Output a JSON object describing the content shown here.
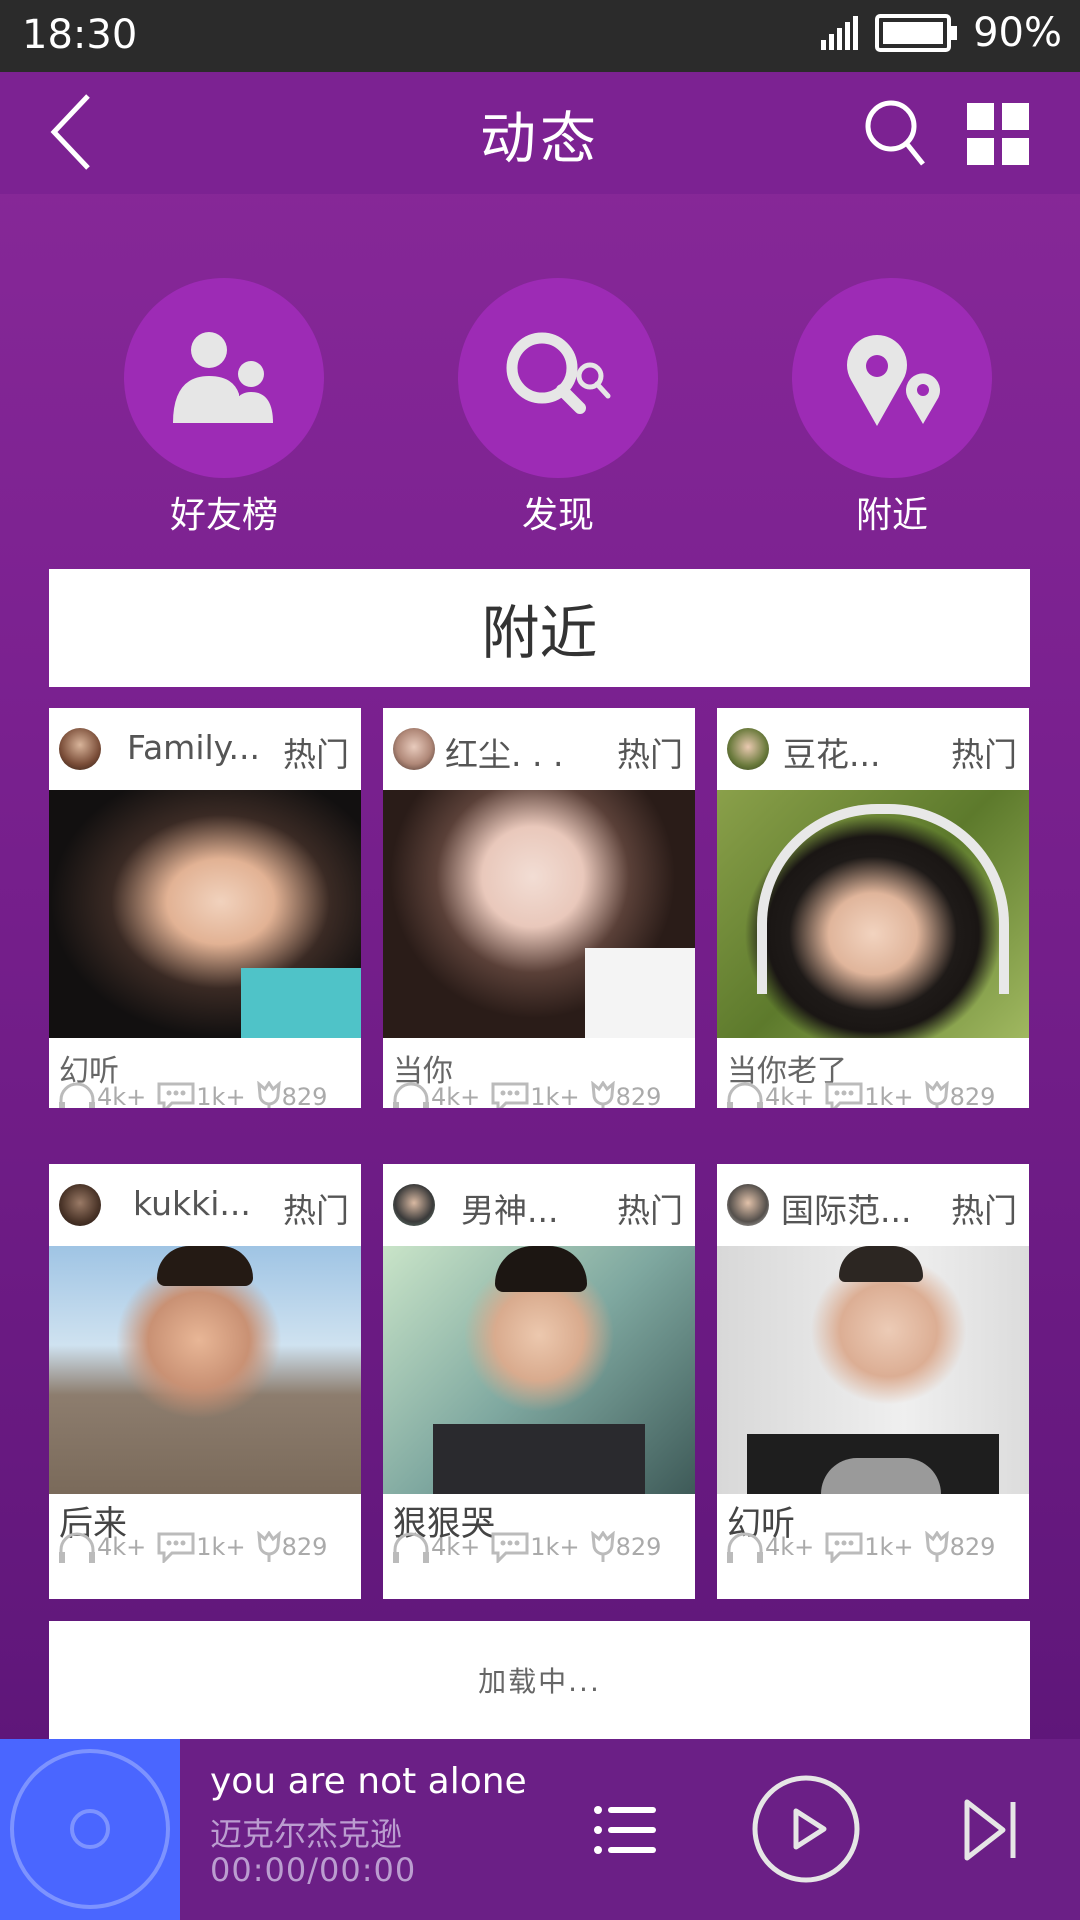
{
  "status": {
    "time": "18:30",
    "battery": "90%"
  },
  "appbar": {
    "title": "动态"
  },
  "shortcuts": [
    {
      "label": "好友榜",
      "icon": "friends-icon"
    },
    {
      "label": "发现",
      "icon": "discover-search-icon"
    },
    {
      "label": "附近",
      "icon": "nearby-location-icon"
    }
  ],
  "section": {
    "title": "附近"
  },
  "cards": [
    {
      "user": "Family...",
      "hot": "热门",
      "song": "幻听",
      "listens": "4k+",
      "comments": "1k+",
      "likes": "829"
    },
    {
      "user": "红尘. . .",
      "hot": "热门",
      "song": "当你",
      "listens": "4k+",
      "comments": "1k+",
      "likes": "829"
    },
    {
      "user": "豆花...",
      "hot": "热门",
      "song": "当你老了",
      "listens": "4k+",
      "comments": "1k+",
      "likes": "829"
    },
    {
      "user": "kukki...",
      "hot": "热门",
      "song": "后来",
      "listens": "4k+",
      "comments": "1k+",
      "likes": "829"
    },
    {
      "user": "男神...",
      "hot": "热门",
      "song": "狠狠哭",
      "listens": "4k+",
      "comments": "1k+",
      "likes": "829"
    },
    {
      "user": "国际范...",
      "hot": "热门",
      "song": "幻听",
      "listens": "4k+",
      "comments": "1k+",
      "likes": "829"
    }
  ],
  "loading": {
    "text": "加载中..."
  },
  "player": {
    "song": "you are not alone",
    "artist": "迈克尔杰克逊",
    "time": "00:00/00:00"
  },
  "colors": {
    "appbar": "#7c2292",
    "shortcut_circle": "#9d2bb5",
    "player_bg": "#6b1f86",
    "disc_bg": "#4a66ff"
  }
}
